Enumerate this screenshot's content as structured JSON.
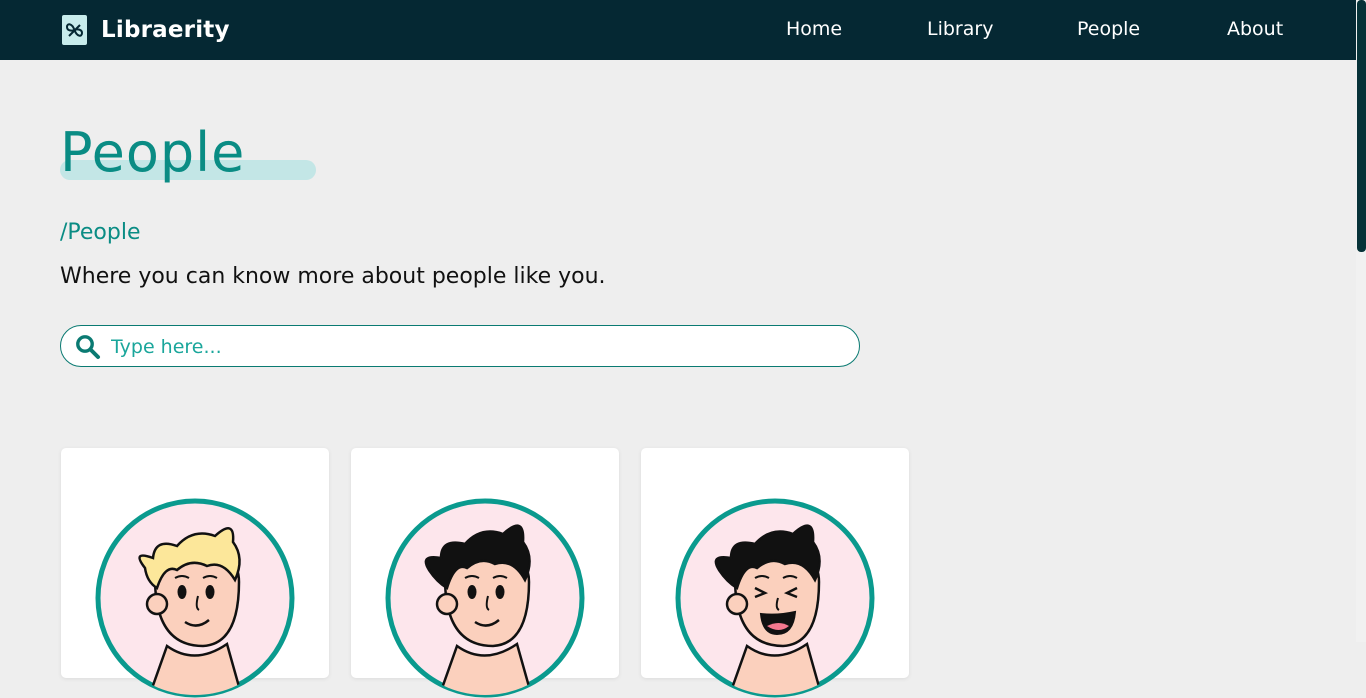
{
  "nav": {
    "brand": "Libraerity",
    "links": [
      "Home",
      "Library",
      "People",
      "About"
    ]
  },
  "page": {
    "title": "People",
    "breadcrumb": "/People",
    "subtitle": "Where you can know more about people like you."
  },
  "search": {
    "placeholder": "Type here..."
  },
  "people_cards": [
    {
      "avatar": "blond-man-smiling-avatar"
    },
    {
      "avatar": "dark-haired-man-smiling-avatar"
    },
    {
      "avatar": "dark-haired-man-laughing-avatar"
    }
  ],
  "colors": {
    "navbar": "#052833",
    "accent": "#0a8c84",
    "title_highlight": "#c3e6e6",
    "background": "#eeeeee",
    "avatar_ring": "#0a9a8e",
    "avatar_fill": "#fde6ec"
  }
}
